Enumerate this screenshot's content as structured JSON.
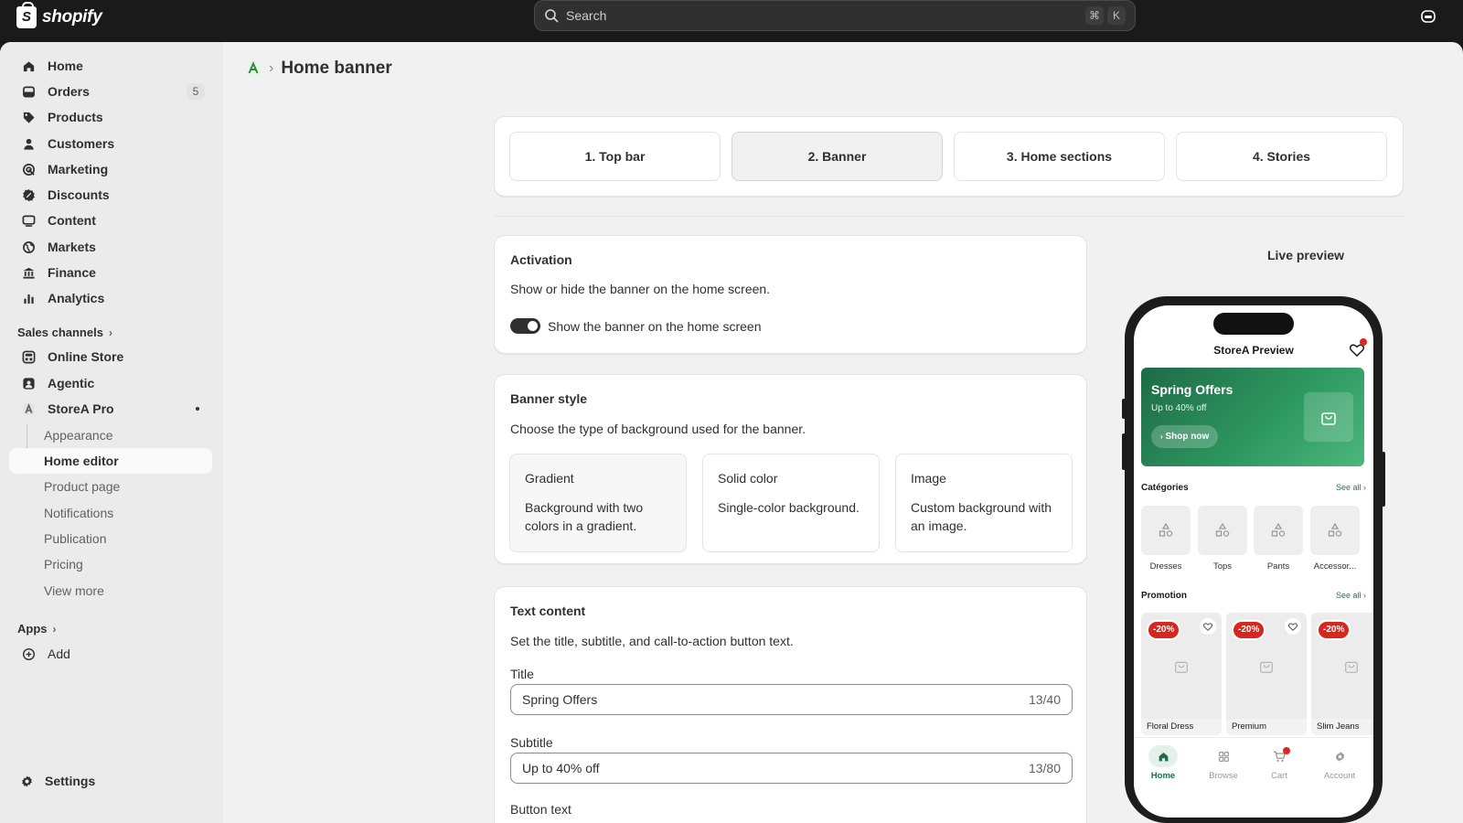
{
  "topbar": {
    "brand": "shopify",
    "search_placeholder": "Search",
    "shortcut_keys": [
      "⌘",
      "K"
    ]
  },
  "sidebar": {
    "main_items": [
      {
        "label": "Home",
        "icon": "home-icon"
      },
      {
        "label": "Orders",
        "icon": "orders-icon",
        "badge": "5"
      },
      {
        "label": "Products",
        "icon": "tag-icon"
      },
      {
        "label": "Customers",
        "icon": "person-icon"
      },
      {
        "label": "Marketing",
        "icon": "target-icon"
      },
      {
        "label": "Discounts",
        "icon": "discount-icon"
      },
      {
        "label": "Content",
        "icon": "content-icon"
      },
      {
        "label": "Markets",
        "icon": "globe-icon"
      },
      {
        "label": "Finance",
        "icon": "bank-icon"
      },
      {
        "label": "Analytics",
        "icon": "bar-chart-icon"
      }
    ],
    "sales_channels_label": "Sales channels",
    "channels": [
      {
        "label": "Online Store",
        "icon": "store-icon"
      },
      {
        "label": "Agentic",
        "icon": "agentic-icon"
      },
      {
        "label": "StoreA Pro",
        "icon": "app-a-icon"
      }
    ],
    "sub_items": [
      "Appearance",
      "Home editor",
      "Product page",
      "Notifications",
      "Publication",
      "Pricing",
      "View more"
    ],
    "active_sub": "Home editor",
    "apps_label": "Apps",
    "add_label": "Add",
    "settings_label": "Settings"
  },
  "page": {
    "title": "Home banner"
  },
  "steps": [
    "1. Top bar",
    "2. Banner",
    "3. Home sections",
    "4. Stories"
  ],
  "active_step": "2. Banner",
  "activation": {
    "title": "Activation",
    "description": "Show or hide the banner on the home screen.",
    "toggle_label": "Show the banner on the home screen",
    "toggle_on": true
  },
  "banner_style": {
    "title": "Banner style",
    "description": "Choose the type of background used for the banner.",
    "options": [
      {
        "title": "Gradient",
        "desc": "Background with two colors in a gradient.",
        "selected": true
      },
      {
        "title": "Solid color",
        "desc": "Single-color background.",
        "selected": false
      },
      {
        "title": "Image",
        "desc": "Custom background with an image.",
        "selected": false
      }
    ]
  },
  "text_content": {
    "title": "Text content",
    "description": "Set the title, subtitle, and call-to-action button text.",
    "fields": [
      {
        "label": "Title",
        "value": "Spring Offers",
        "count": "13/40"
      },
      {
        "label": "Subtitle",
        "value": "Up to 40% off",
        "count": "13/80"
      }
    ],
    "button_text_label": "Button text"
  },
  "preview": {
    "label": "Live preview",
    "store_title": "StoreA Preview",
    "banner_title": "Spring Offers",
    "banner_subtitle": "Up to 40% off",
    "banner_button": "Shop now",
    "categories_title": "Catégories",
    "see_all": "See all",
    "categories": [
      "Dresses",
      "Tops",
      "Pants",
      "Accessor..."
    ],
    "promotion_title": "Promotion",
    "products": [
      {
        "name": "Floral Dress",
        "discount": "-20%"
      },
      {
        "name": "Premium",
        "discount": "-20%"
      },
      {
        "name": "Slim Jeans",
        "discount": "-20%"
      }
    ],
    "tabbar": [
      "Home",
      "Browse",
      "Cart",
      "Account"
    ],
    "active_tab": "Home"
  },
  "colors": {
    "topbar_bg": "#1a1a1a",
    "banner_gradient_start": "#1e6b47",
    "banner_gradient_end": "#4bb77c",
    "discount_badge": "#d7261e",
    "accent_green": "#1e7a4a"
  }
}
